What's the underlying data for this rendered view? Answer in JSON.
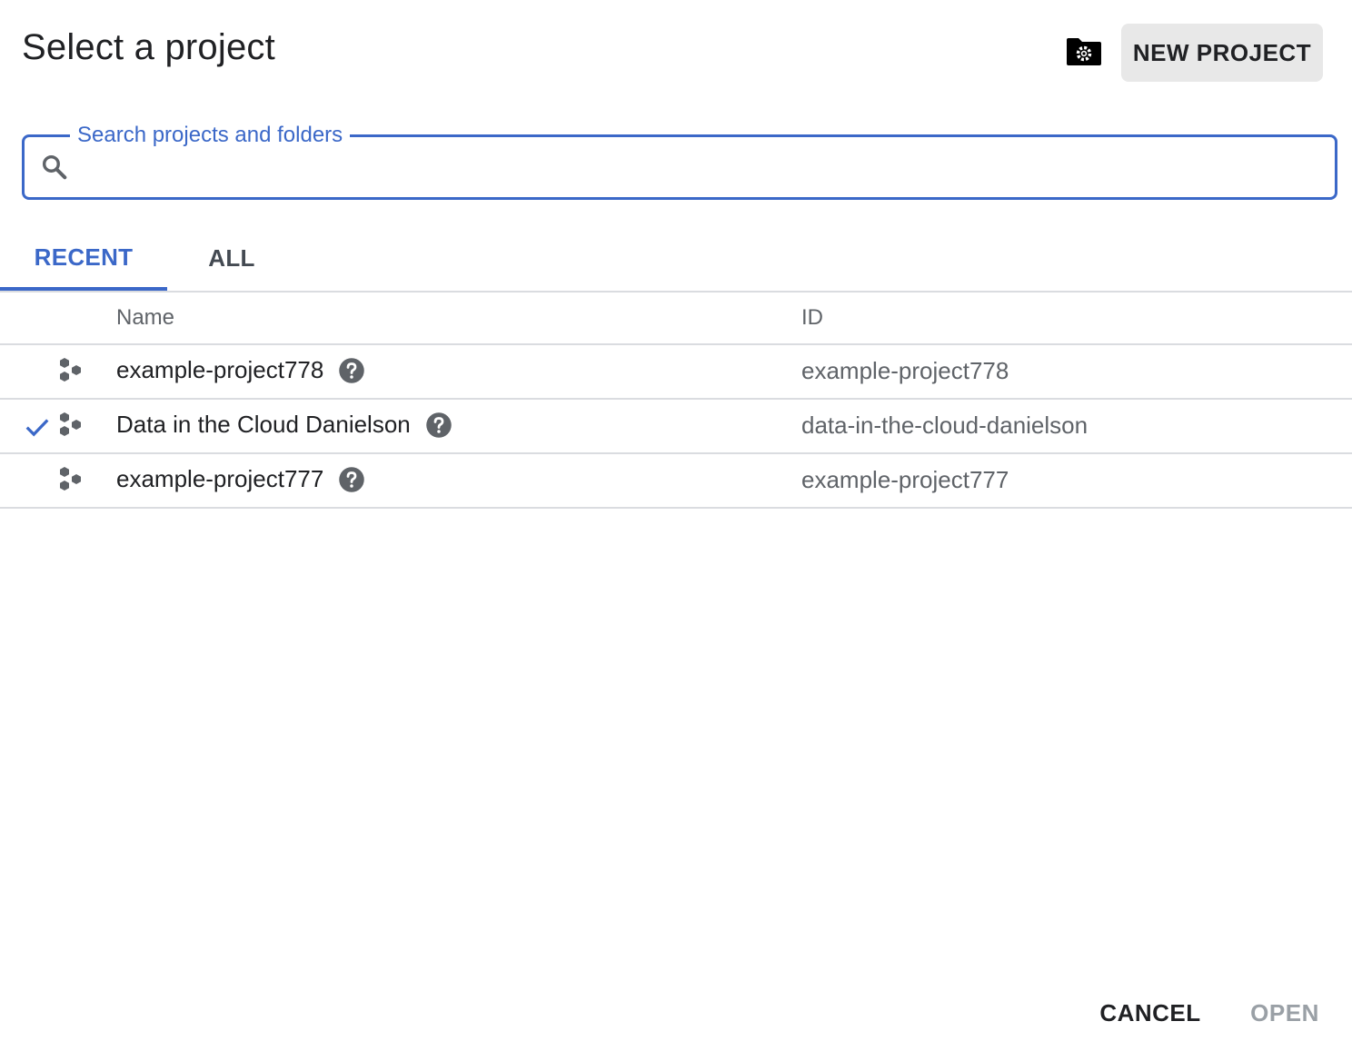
{
  "dialog": {
    "title": "Select a project",
    "new_project_label": "NEW PROJECT"
  },
  "search": {
    "label": "Search projects and folders",
    "value": "",
    "placeholder": ""
  },
  "tabs": [
    {
      "label": "RECENT",
      "active": true
    },
    {
      "label": "ALL",
      "active": false
    }
  ],
  "table": {
    "headers": {
      "name": "Name",
      "id": "ID"
    },
    "rows": [
      {
        "name": "example-project778",
        "id": "example-project778",
        "selected": false
      },
      {
        "name": "Data in the Cloud Danielson",
        "id": "data-in-the-cloud-danielson",
        "selected": true
      },
      {
        "name": "example-project777",
        "id": "example-project777",
        "selected": false
      }
    ]
  },
  "footer": {
    "cancel_label": "CANCEL",
    "open_label": "OPEN"
  },
  "colors": {
    "accent": "#3b68c8",
    "icon_dark": "#5f6368"
  },
  "icons": [
    "manage-resources-icon",
    "search-icon",
    "check-icon",
    "project-icon",
    "help-icon"
  ]
}
